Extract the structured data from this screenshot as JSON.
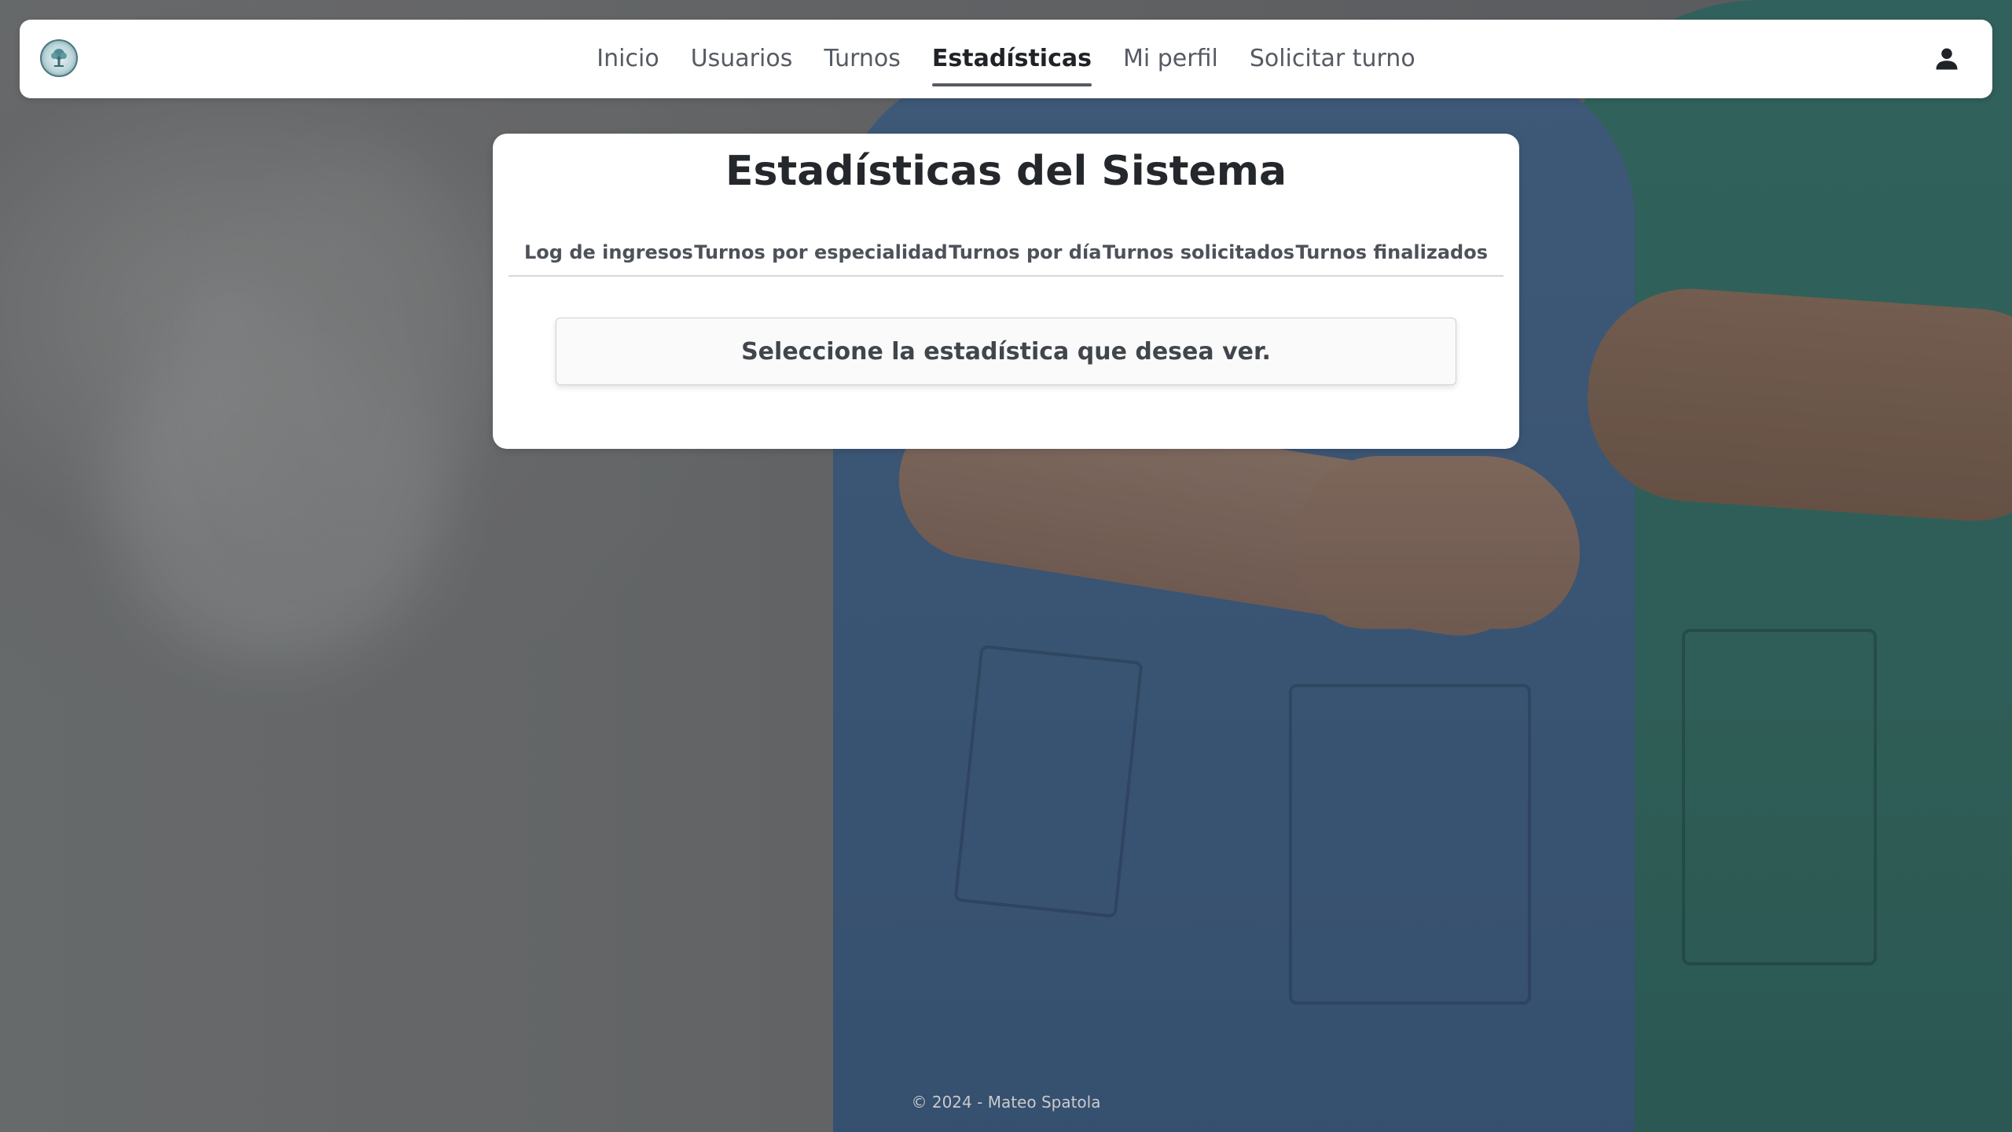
{
  "navbar": {
    "logo_icon": "medical-tree-logo-icon",
    "links": [
      {
        "label": "Inicio",
        "active": false
      },
      {
        "label": "Usuarios",
        "active": false
      },
      {
        "label": "Turnos",
        "active": false
      },
      {
        "label": "Estadísticas",
        "active": true
      },
      {
        "label": "Mi perfil",
        "active": false
      },
      {
        "label": "Solicitar turno",
        "active": false
      }
    ],
    "user_icon": "user-icon"
  },
  "main": {
    "title": "Estadísticas del Sistema",
    "tabs": [
      {
        "label": "Log de ingresos"
      },
      {
        "label": "Turnos por especialidad"
      },
      {
        "label": "Turnos por día"
      },
      {
        "label": "Turnos solicitados"
      },
      {
        "label": "Turnos finalizados"
      }
    ],
    "message": "Seleccione la estadística que desea ver."
  },
  "footer": {
    "text": "© 2024 - Mateo Spatola"
  },
  "colors": {
    "nav_text": "#555a63",
    "nav_active": "#1f2227",
    "card_bg": "#ffffff"
  }
}
